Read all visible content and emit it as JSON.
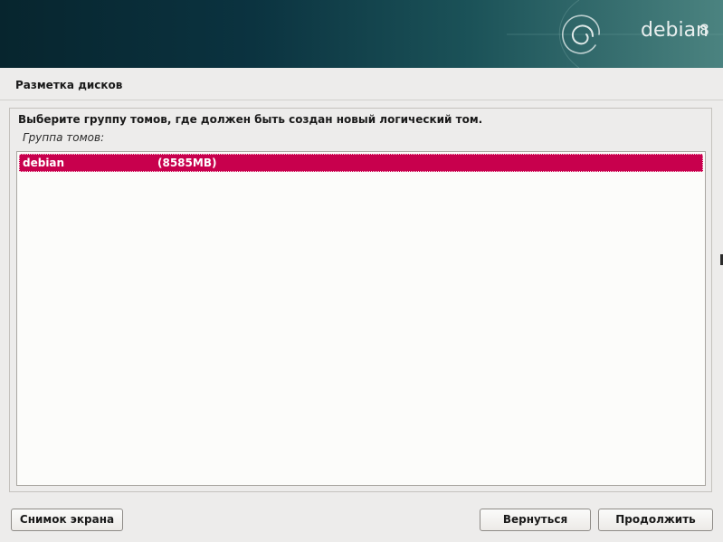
{
  "banner": {
    "logo_text": "debian",
    "logo_version": "8",
    "logo_icon": "debian-swirl-icon"
  },
  "page": {
    "title": "Разметка дисков"
  },
  "main": {
    "question": "Выберите группу томов, где должен быть создан новый логический том.",
    "list_label": "Группа томов:",
    "items": [
      {
        "name": "debian",
        "size": "(8585MB)",
        "selected": true
      }
    ]
  },
  "buttons": {
    "screenshot": "Снимок экрана",
    "back": "Вернуться",
    "continue": "Продолжить"
  },
  "colors": {
    "selection": "#c8004d",
    "banner_dark": "#0b3340",
    "background": "#edeceb"
  }
}
